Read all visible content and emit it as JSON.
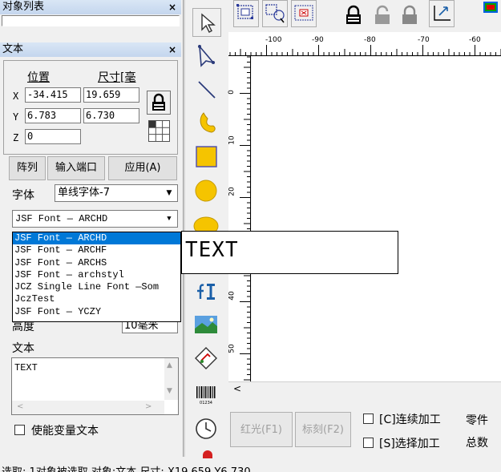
{
  "object_list": {
    "title": "对象列表",
    "close": "×"
  },
  "text_panel": {
    "title": "文本",
    "close": "×",
    "position_label": "位置",
    "size_label": "尺寸[毫",
    "x_label": "X",
    "y_label": "Y",
    "z_label": "Z",
    "x_pos": "-34.415",
    "x_size": "19.659",
    "y_pos": "6.783",
    "y_size": "6.730",
    "z_pos": "0",
    "array_button": "阵列",
    "input_port_button": "输入端口",
    "apply_button": "应用(A)",
    "font_label": "字体",
    "font_type": "单线字体-7",
    "font_name": "JSF Font — ARCHD",
    "font_options": [
      "JSF Font — ARCHD",
      "JSF Font — ARCHF",
      "JSF Font — ARCHS",
      "JSF Font — archstyl",
      "JCZ Single Line Font —Som",
      "JczTest",
      "JSF Font — YCZY"
    ],
    "height_label": "高度",
    "height_value": "10毫米",
    "text_label": "文本",
    "text_value": "TEXT",
    "variable_text_label": "使能变量文本"
  },
  "canvas": {
    "ruler_top_labels": [
      "-100",
      "-90",
      "-80",
      "-70",
      "-60"
    ],
    "ruler_left_labels": [
      "0",
      "10",
      "20",
      "30",
      "40",
      "50"
    ],
    "text_object": "TEXT"
  },
  "bottom_bar": {
    "red_light_button": "红光(F1)",
    "mark_button": "标刻(F2)",
    "continuous_label": "[C]连续加工",
    "select_label": "[S]选择加工",
    "parts_label": "零件",
    "total_label": "总数"
  },
  "status_bar": {
    "text": "选取: 1对象被选取 对象:文本 尺寸: X19.659 Y6.730"
  },
  "colors": {
    "selection": "#0078d7",
    "panel_title": "#c4d6ee",
    "tool_yellow": "#f5c400"
  }
}
